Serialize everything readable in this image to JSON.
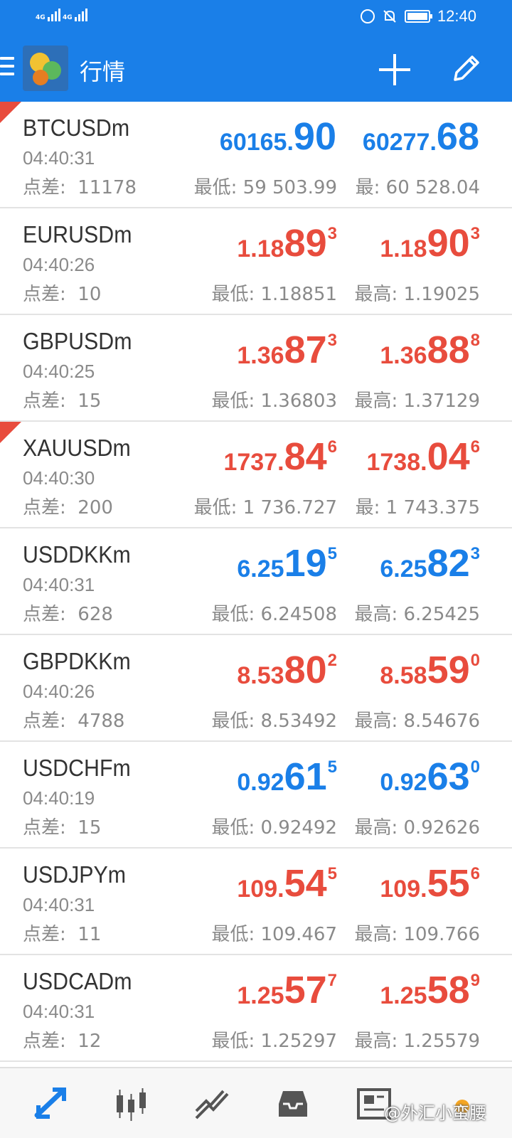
{
  "status_bar": {
    "signal_1": "4G",
    "signal_2": "4G",
    "time": "12:40"
  },
  "app_bar": {
    "title": "行情"
  },
  "quotes": [
    {
      "symbol": "BTCUSDm",
      "time": "04:40:31",
      "spread_label": "点差:",
      "spread": "11178",
      "bid_prefix": "60165.",
      "bid_big": "90",
      "bid_sup": "",
      "bid_color": "blue",
      "ask_prefix": "60277.",
      "ask_big": "68",
      "ask_sup": "",
      "ask_color": "blue",
      "low": "最低: 59 503.99",
      "high": "最: 60 528.04",
      "flag": true
    },
    {
      "symbol": "EURUSDm",
      "time": "04:40:26",
      "spread_label": "点差:",
      "spread": "10",
      "bid_prefix": "1.18",
      "bid_big": "89",
      "bid_sup": "3",
      "bid_color": "red",
      "ask_prefix": "1.18",
      "ask_big": "90",
      "ask_sup": "3",
      "ask_color": "red",
      "low": "最低: 1.18851",
      "high": "最高: 1.19025",
      "flag": false
    },
    {
      "symbol": "GBPUSDm",
      "time": "04:40:25",
      "spread_label": "点差:",
      "spread": "15",
      "bid_prefix": "1.36",
      "bid_big": "87",
      "bid_sup": "3",
      "bid_color": "red",
      "ask_prefix": "1.36",
      "ask_big": "88",
      "ask_sup": "8",
      "ask_color": "red",
      "low": "最低: 1.36803",
      "high": "最高: 1.37129",
      "flag": false
    },
    {
      "symbol": "XAUUSDm",
      "time": "04:40:30",
      "spread_label": "点差:",
      "spread": "200",
      "bid_prefix": "1737.",
      "bid_big": "84",
      "bid_sup": "6",
      "bid_color": "red",
      "ask_prefix": "1738.",
      "ask_big": "04",
      "ask_sup": "6",
      "ask_color": "red",
      "low": "最低: 1 736.727",
      "high": "最: 1 743.375",
      "flag": true
    },
    {
      "symbol": "USDDKKm",
      "time": "04:40:31",
      "spread_label": "点差:",
      "spread": "628",
      "bid_prefix": "6.25",
      "bid_big": "19",
      "bid_sup": "5",
      "bid_color": "blue",
      "ask_prefix": "6.25",
      "ask_big": "82",
      "ask_sup": "3",
      "ask_color": "blue",
      "low": "最低: 6.24508",
      "high": "最高: 6.25425",
      "flag": false
    },
    {
      "symbol": "GBPDKKm",
      "time": "04:40:26",
      "spread_label": "点差:",
      "spread": "4788",
      "bid_prefix": "8.53",
      "bid_big": "80",
      "bid_sup": "2",
      "bid_color": "red",
      "ask_prefix": "8.58",
      "ask_big": "59",
      "ask_sup": "0",
      "ask_color": "red",
      "low": "最低: 8.53492",
      "high": "最高: 8.54676",
      "flag": false
    },
    {
      "symbol": "USDCHFm",
      "time": "04:40:19",
      "spread_label": "点差:",
      "spread": "15",
      "bid_prefix": "0.92",
      "bid_big": "61",
      "bid_sup": "5",
      "bid_color": "blue",
      "ask_prefix": "0.92",
      "ask_big": "63",
      "ask_sup": "0",
      "ask_color": "blue",
      "low": "最低: 0.92492",
      "high": "最高: 0.92626",
      "flag": false
    },
    {
      "symbol": "USDJPYm",
      "time": "04:40:31",
      "spread_label": "点差:",
      "spread": "11",
      "bid_prefix": "109.",
      "bid_big": "54",
      "bid_sup": "5",
      "bid_color": "red",
      "ask_prefix": "109.",
      "ask_big": "55",
      "ask_sup": "6",
      "ask_color": "red",
      "low": "最低: 109.467",
      "high": "最高: 109.766",
      "flag": false
    },
    {
      "symbol": "USDCADm",
      "time": "04:40:31",
      "spread_label": "点差:",
      "spread": "12",
      "bid_prefix": "1.25",
      "bid_big": "57",
      "bid_sup": "7",
      "bid_color": "red",
      "ask_prefix": "1.25",
      "ask_big": "58",
      "ask_sup": "9",
      "ask_color": "red",
      "low": "最低: 1.25297",
      "high": "最高: 1.25579",
      "flag": false
    }
  ],
  "bottom_nav": {
    "items": [
      "quotes-icon",
      "chart-icon",
      "trade-icon",
      "history-icon",
      "news-icon"
    ],
    "watermark": "@外汇小蛮腰"
  },
  "colors": {
    "accent": "#1a7fe8",
    "down_red": "#e84c3d",
    "up_blue": "#1a7fe8",
    "muted": "#8a8a8a"
  }
}
